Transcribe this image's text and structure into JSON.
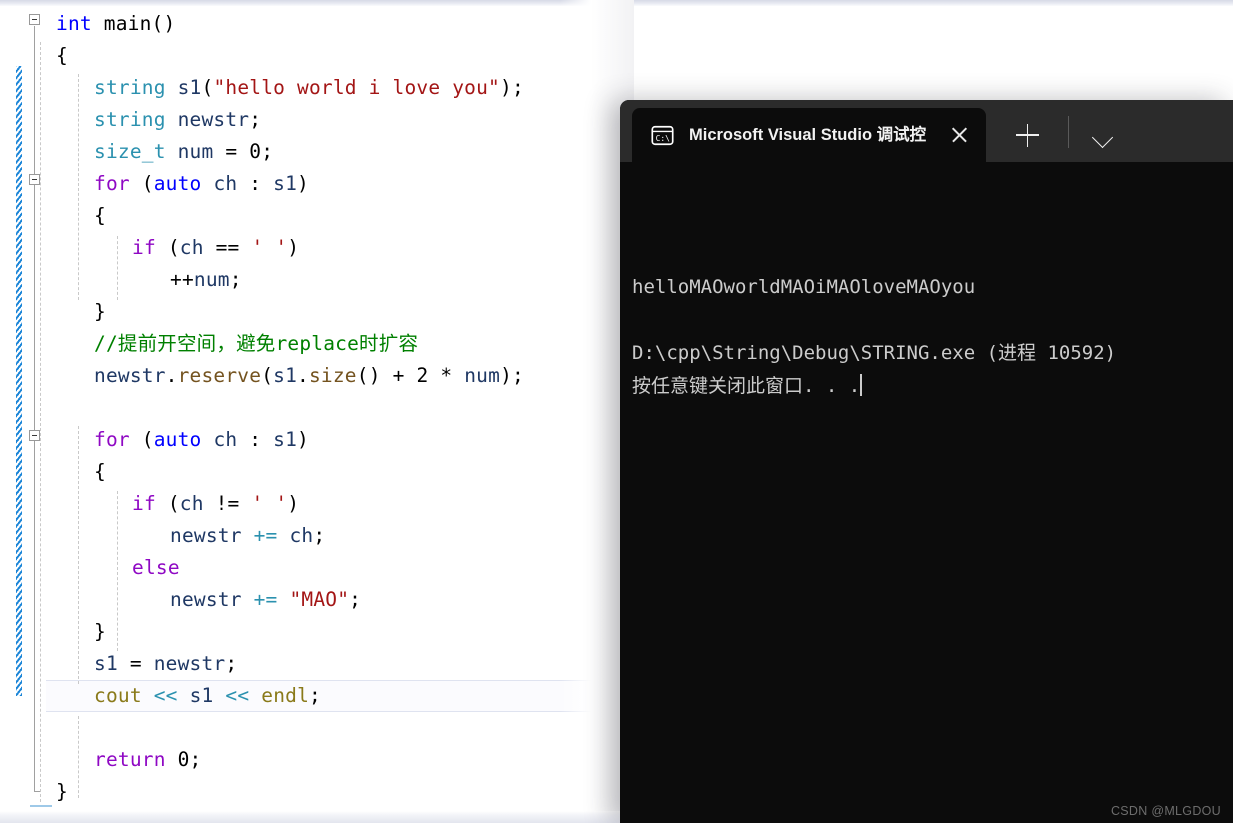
{
  "editor": {
    "name": "visual-studio-code-editor",
    "language": "cpp",
    "background": "#ffffff",
    "change_bar_color": "#1c86d8",
    "current_line_index": 18,
    "lines": [
      {
        "indent": 0,
        "tokens": [
          {
            "t": "int ",
            "c": "kw2"
          },
          {
            "t": "main",
            "c": "plain"
          },
          {
            "t": "()",
            "c": "plain"
          }
        ]
      },
      {
        "indent": 0,
        "tokens": [
          {
            "t": "{",
            "c": "plain"
          }
        ]
      },
      {
        "indent": 1,
        "tokens": [
          {
            "t": "string",
            "c": "type"
          },
          {
            "t": " ",
            "c": "plain"
          },
          {
            "t": "s1",
            "c": "var"
          },
          {
            "t": "(",
            "c": "plain"
          },
          {
            "t": "\"hello world i love you\"",
            "c": "str"
          },
          {
            "t": ");",
            "c": "plain"
          }
        ]
      },
      {
        "indent": 1,
        "tokens": [
          {
            "t": "string",
            "c": "type"
          },
          {
            "t": " ",
            "c": "plain"
          },
          {
            "t": "newstr",
            "c": "var"
          },
          {
            "t": ";",
            "c": "plain"
          }
        ]
      },
      {
        "indent": 1,
        "tokens": [
          {
            "t": "size_t",
            "c": "type"
          },
          {
            "t": " ",
            "c": "plain"
          },
          {
            "t": "num",
            "c": "var"
          },
          {
            "t": " = ",
            "c": "plain"
          },
          {
            "t": "0",
            "c": "num"
          },
          {
            "t": ";",
            "c": "plain"
          }
        ]
      },
      {
        "indent": 1,
        "tokens": [
          {
            "t": "for",
            "c": "kw"
          },
          {
            "t": " (",
            "c": "plain"
          },
          {
            "t": "auto",
            "c": "kw2"
          },
          {
            "t": " ",
            "c": "plain"
          },
          {
            "t": "ch",
            "c": "var"
          },
          {
            "t": " : ",
            "c": "plain"
          },
          {
            "t": "s1",
            "c": "var"
          },
          {
            "t": ")",
            "c": "plain"
          }
        ]
      },
      {
        "indent": 1,
        "tokens": [
          {
            "t": "{",
            "c": "plain"
          }
        ]
      },
      {
        "indent": 2,
        "tokens": [
          {
            "t": "if",
            "c": "kw"
          },
          {
            "t": " (",
            "c": "plain"
          },
          {
            "t": "ch",
            "c": "var"
          },
          {
            "t": " == ",
            "c": "plain"
          },
          {
            "t": "' '",
            "c": "str"
          },
          {
            "t": ")",
            "c": "plain"
          }
        ]
      },
      {
        "indent": 3,
        "tokens": [
          {
            "t": "++",
            "c": "plain"
          },
          {
            "t": "num",
            "c": "var"
          },
          {
            "t": ";",
            "c": "plain"
          }
        ]
      },
      {
        "indent": 1,
        "tokens": [
          {
            "t": "}",
            "c": "plain"
          }
        ]
      },
      {
        "indent": 1,
        "tokens": [
          {
            "t": "//提前开空间，避免replace时扩容",
            "c": "comment"
          }
        ]
      },
      {
        "indent": 1,
        "tokens": [
          {
            "t": "newstr",
            "c": "var"
          },
          {
            "t": ".",
            "c": "plain"
          },
          {
            "t": "reserve",
            "c": "fn"
          },
          {
            "t": "(",
            "c": "plain"
          },
          {
            "t": "s1",
            "c": "var"
          },
          {
            "t": ".",
            "c": "plain"
          },
          {
            "t": "size",
            "c": "fn"
          },
          {
            "t": "() + ",
            "c": "plain"
          },
          {
            "t": "2",
            "c": "num"
          },
          {
            "t": " * ",
            "c": "plain"
          },
          {
            "t": "num",
            "c": "var"
          },
          {
            "t": ");",
            "c": "plain"
          }
        ]
      },
      {
        "indent": 0,
        "tokens": [
          {
            "t": "",
            "c": "plain"
          }
        ]
      },
      {
        "indent": 1,
        "tokens": [
          {
            "t": "for",
            "c": "kw"
          },
          {
            "t": " (",
            "c": "plain"
          },
          {
            "t": "auto",
            "c": "kw2"
          },
          {
            "t": " ",
            "c": "plain"
          },
          {
            "t": "ch",
            "c": "var"
          },
          {
            "t": " : ",
            "c": "plain"
          },
          {
            "t": "s1",
            "c": "var"
          },
          {
            "t": ")",
            "c": "plain"
          }
        ]
      },
      {
        "indent": 1,
        "tokens": [
          {
            "t": "{",
            "c": "plain"
          }
        ]
      },
      {
        "indent": 2,
        "tokens": [
          {
            "t": "if",
            "c": "kw"
          },
          {
            "t": " (",
            "c": "plain"
          },
          {
            "t": "ch",
            "c": "var"
          },
          {
            "t": " != ",
            "c": "plain"
          },
          {
            "t": "' '",
            "c": "str"
          },
          {
            "t": ")",
            "c": "plain"
          }
        ]
      },
      {
        "indent": 3,
        "tokens": [
          {
            "t": "newstr",
            "c": "var"
          },
          {
            "t": " ",
            "c": "plain"
          },
          {
            "t": "+=",
            "c": "stream"
          },
          {
            "t": " ",
            "c": "plain"
          },
          {
            "t": "ch",
            "c": "var"
          },
          {
            "t": ";",
            "c": "plain"
          }
        ]
      },
      {
        "indent": 2,
        "tokens": [
          {
            "t": "else",
            "c": "kw"
          }
        ]
      },
      {
        "indent": 3,
        "tokens": [
          {
            "t": "newstr",
            "c": "var"
          },
          {
            "t": " ",
            "c": "plain"
          },
          {
            "t": "+=",
            "c": "stream"
          },
          {
            "t": " ",
            "c": "plain"
          },
          {
            "t": "\"MAO\"",
            "c": "str"
          },
          {
            "t": ";",
            "c": "plain"
          }
        ]
      },
      {
        "indent": 1,
        "tokens": [
          {
            "t": "}",
            "c": "plain"
          }
        ]
      },
      {
        "indent": 1,
        "tokens": [
          {
            "t": "s1",
            "c": "var"
          },
          {
            "t": " = ",
            "c": "plain"
          },
          {
            "t": "newstr",
            "c": "var"
          },
          {
            "t": ";",
            "c": "plain"
          }
        ]
      },
      {
        "indent": 1,
        "tokens": [
          {
            "t": "cout",
            "c": "cout"
          },
          {
            "t": " ",
            "c": "plain"
          },
          {
            "t": "<<",
            "c": "stream"
          },
          {
            "t": " ",
            "c": "plain"
          },
          {
            "t": "s1",
            "c": "var"
          },
          {
            "t": " ",
            "c": "plain"
          },
          {
            "t": "<<",
            "c": "stream"
          },
          {
            "t": " ",
            "c": "plain"
          },
          {
            "t": "endl",
            "c": "cout"
          },
          {
            "t": ";",
            "c": "plain"
          }
        ]
      },
      {
        "indent": 0,
        "tokens": [
          {
            "t": "",
            "c": "plain"
          }
        ]
      },
      {
        "indent": 1,
        "tokens": [
          {
            "t": "return",
            "c": "kw"
          },
          {
            "t": " ",
            "c": "plain"
          },
          {
            "t": "0",
            "c": "num"
          },
          {
            "t": ";",
            "c": "plain"
          }
        ]
      },
      {
        "indent": 0,
        "tokens": [
          {
            "t": "}",
            "c": "plain"
          }
        ]
      }
    ],
    "code_plain_text": "int main()\n{\n    string s1(\"hello world i love you\");\n    string newstr;\n    size_t num = 0;\n    for (auto ch : s1)\n    {\n        if (ch == ' ')\n            ++num;\n    }\n    //提前开空间，避免replace时扩容\n    newstr.reserve(s1.size() + 2 * num);\n\n    for (auto ch : s1)\n    {\n        if (ch != ' ')\n            newstr += ch;\n        else\n            newstr += \"MAO\";\n    }\n    s1 = newstr;\n    cout << s1 << endl;\n\n    return 0;\n}"
  },
  "terminal": {
    "name": "windows-terminal",
    "tab": {
      "icon": "command-prompt-icon",
      "title": "Microsoft Visual Studio 调试控",
      "close_label": "×"
    },
    "controls": {
      "new_tab_label": "+",
      "dropdown_label": "⌄"
    },
    "background": "#0c0c0c",
    "titlebar_background": "#2b2b2b",
    "output_lines": [
      "helloMAOworldMAOiMAOloveMAOyou",
      "",
      "D:\\cpp\\String\\Debug\\STRING.exe (进程 10592)",
      "按任意键关闭此窗口. . ."
    ]
  },
  "watermark": {
    "text": "CSDN @MLGDOU"
  }
}
